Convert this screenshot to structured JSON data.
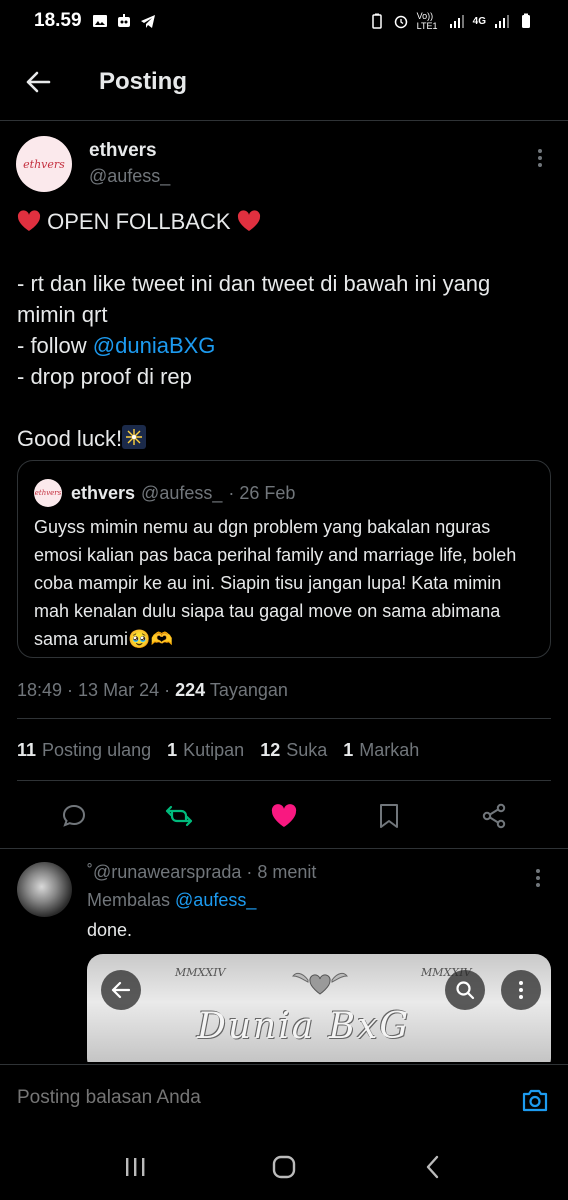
{
  "status_bar": {
    "time": "18.59",
    "network": "Vo)) LTE1",
    "network_type": "4G"
  },
  "header": {
    "title": "Posting"
  },
  "post": {
    "author_name": "ethvers",
    "author_handle": "@aufess_",
    "avatar_text": "ethvers",
    "line1": "OPEN FOLLBACK",
    "line2": "- rt dan like tweet ini dan tweet di bawah ini yang mimin qrt",
    "line3_prefix": "- follow ",
    "line3_mention": "@duniaBXG",
    "line4": "- drop proof di rep",
    "line5": "Good luck!"
  },
  "quote": {
    "author_name": "ethvers",
    "author_handle": "@aufess_",
    "date": "· 26 Feb",
    "text": "Guyss mimin nemu au dgn problem yang bakalan nguras emosi kalian pas baca perihal family and marriage life, boleh coba mampir ke au ini. Siapin tisu jangan lupa! Kata mimin mah kenalan dulu siapa tau gagal move on sama abimana sama arumi🥹🫶"
  },
  "meta": {
    "time": "18:49 · 13 Mar 24 · ",
    "views_count": "224",
    "views_label": " Tayangan"
  },
  "stats": {
    "reposts_count": "11",
    "reposts_label": "Posting ulang",
    "quotes_count": "1",
    "quotes_label": "Kutipan",
    "likes_count": "12",
    "likes_label": "Suka",
    "bookmarks_count": "1",
    "bookmarks_label": "Markah"
  },
  "colors": {
    "accent": "#1d9bf0",
    "like": "#f91880",
    "repost": "#00ba7c",
    "muted": "#71767b"
  },
  "reply": {
    "handle": "˚@runawearsprada",
    "time": " · 8 menit",
    "replying_prefix": "Membalas ",
    "replying_mention": "@aufess_",
    "text": "done.",
    "image_title": "Dunia BxG",
    "image_corner_left": "MMXXIV",
    "image_corner_right": "MMXXIV"
  },
  "reply_bar": {
    "placeholder": "Posting balasan Anda"
  }
}
